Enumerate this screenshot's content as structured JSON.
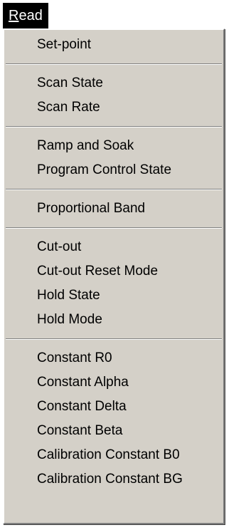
{
  "menubar": {
    "read_mnemonic": "R",
    "read_rest": "ead"
  },
  "menu": {
    "groups": [
      [
        "Set-point"
      ],
      [
        "Scan State",
        "Scan Rate"
      ],
      [
        "Ramp and Soak",
        "Program Control State"
      ],
      [
        "Proportional Band"
      ],
      [
        "Cut-out",
        "Cut-out Reset Mode",
        "Hold State",
        "Hold Mode"
      ],
      [
        "Constant R0",
        "Constant Alpha",
        "Constant Delta",
        "Constant Beta",
        "Calibration Constant B0",
        "Calibration Constant BG"
      ]
    ]
  }
}
